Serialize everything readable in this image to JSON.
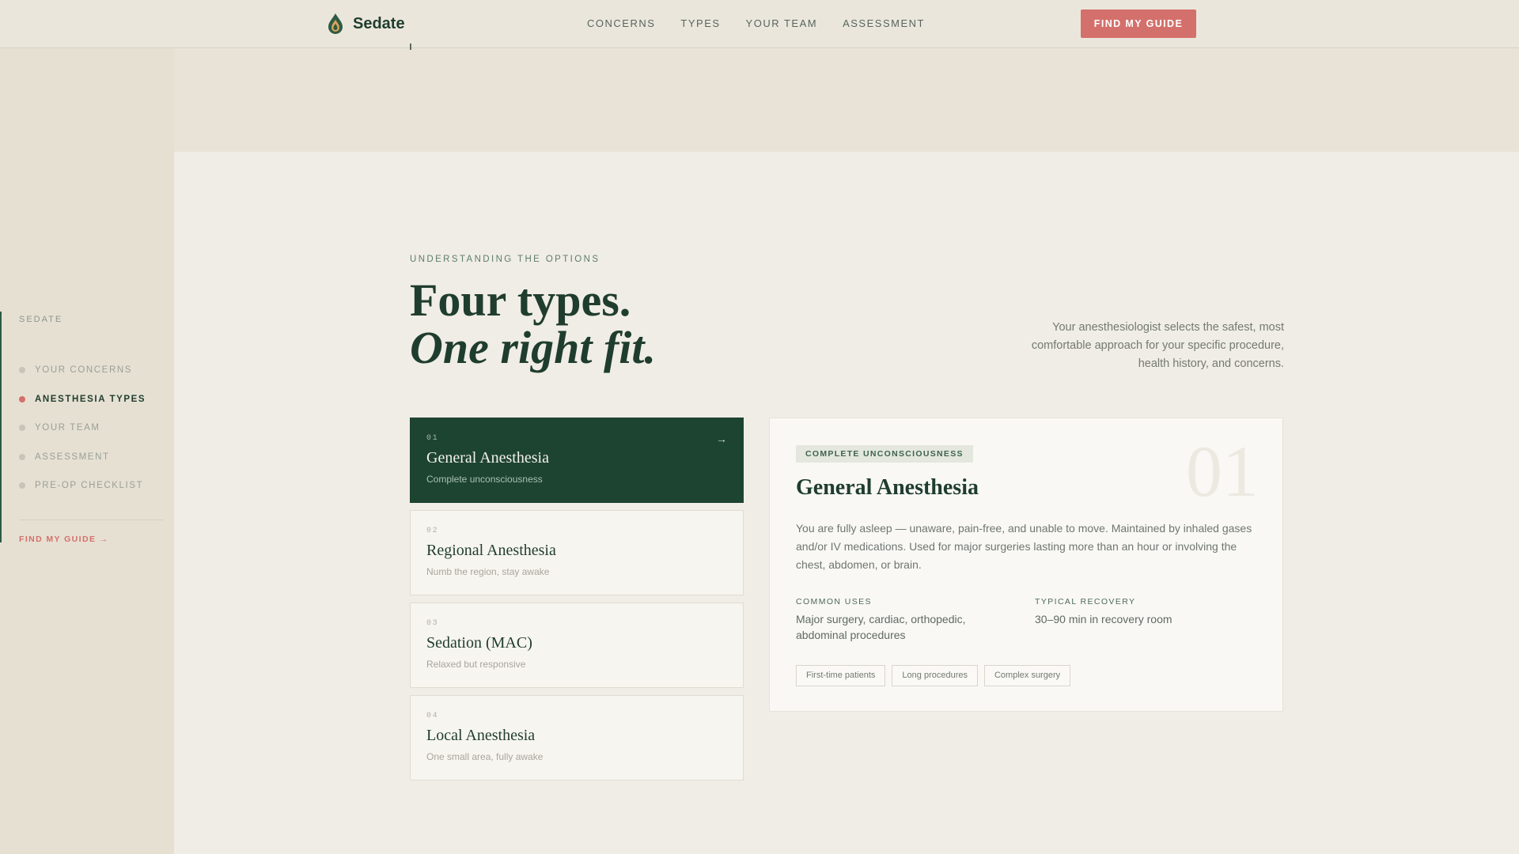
{
  "nav": {
    "brand": "Sedate",
    "links": [
      "CONCERNS",
      "TYPES",
      "YOUR TEAM",
      "ASSESSMENT"
    ],
    "cta": "FIND MY GUIDE",
    "logo_icon": "flame-drop-icon"
  },
  "sidebar": {
    "brand": "SEDATE",
    "items": [
      {
        "label": "YOUR CONCERNS",
        "active": false
      },
      {
        "label": "ANESTHESIA TYPES",
        "active": true
      },
      {
        "label": "YOUR TEAM",
        "active": false
      },
      {
        "label": "ASSESSMENT",
        "active": false
      },
      {
        "label": "PRE-OP CHECKLIST",
        "active": false
      }
    ],
    "cta": "FIND MY GUIDE →"
  },
  "section": {
    "eyebrow": "UNDERSTANDING THE OPTIONS",
    "headline_line1": "Four types.",
    "headline_line2": "One right fit.",
    "intro": "Your anesthesiologist selects the safest, most comfortable approach for your specific procedure, health history, and concerns."
  },
  "types": [
    {
      "num": "01",
      "title": "General Anesthesia",
      "sub": "Complete unconsciousness",
      "active": true
    },
    {
      "num": "02",
      "title": "Regional Anesthesia",
      "sub": "Numb the region, stay awake",
      "active": false
    },
    {
      "num": "03",
      "title": "Sedation (MAC)",
      "sub": "Relaxed but responsive",
      "active": false
    },
    {
      "num": "04",
      "title": "Local Anesthesia",
      "sub": "One small area, fully awake",
      "active": false
    }
  ],
  "detail": {
    "badge": "COMPLETE UNCONSCIOUSNESS",
    "big_num": "01",
    "title": "General Anesthesia",
    "description": "You are fully asleep — unaware, pain-free, and unable to move. Maintained by inhaled gases and/or IV medications. Used for major surgeries lasting more than an hour or involving the chest, abdomen, or brain.",
    "common_uses_label": "COMMON USES",
    "common_uses": "Major surgery, cardiac, orthopedic, abdominal procedures",
    "recovery_label": "TYPICAL RECOVERY",
    "recovery": "30–90 min in recovery room",
    "tags": [
      "First-time patients",
      "Long procedures",
      "Complex surgery"
    ]
  },
  "colors": {
    "accent": "#d4706b",
    "brand_green": "#1d4431",
    "background": "#e9e3d7"
  }
}
